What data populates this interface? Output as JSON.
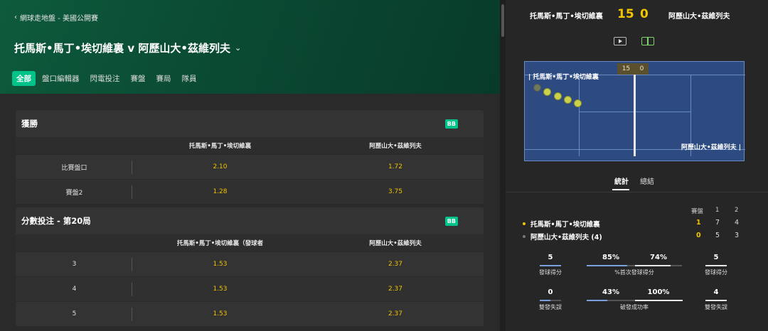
{
  "breadcrumb": {
    "back_icon": "chevron-left-icon",
    "text": "網球走地盤 - 美國公開賽"
  },
  "match": {
    "title": "托馬斯•馬丁•埃切維裏 v 阿歷山大•茲維列夫",
    "dropdown_icon": "chevron-down-icon"
  },
  "tabs": [
    {
      "label": "全部",
      "active": true
    },
    {
      "label": "盤口編輯器",
      "active": false
    },
    {
      "label": "閃電投注",
      "active": false
    },
    {
      "label": "賽盤",
      "active": false
    },
    {
      "label": "賽局",
      "active": false
    },
    {
      "label": "隊員",
      "active": false
    }
  ],
  "markets": [
    {
      "title": "獲勝",
      "badge": "BB",
      "columns": [
        "托馬斯•馬丁•埃切維裏",
        "阿歷山大•茲維列夫"
      ],
      "rows": [
        {
          "label": "比賽盤口",
          "odds": [
            "2.10",
            "1.72"
          ]
        },
        {
          "label": "賽盤2",
          "odds": [
            "1.28",
            "3.75"
          ]
        }
      ]
    },
    {
      "title": "分數投注 - 第20局",
      "badge": "BB",
      "columns": [
        "托馬斯•馬丁•埃切維裏（發球者",
        "阿歷山大•茲維列夫"
      ],
      "rows": [
        {
          "label": "3",
          "odds": [
            "1.53",
            "2.37"
          ]
        },
        {
          "label": "4",
          "odds": [
            "1.53",
            "2.37"
          ]
        },
        {
          "label": "5",
          "odds": [
            "1.53",
            "2.37"
          ]
        }
      ]
    }
  ],
  "scoreboard": {
    "player1": "托馬斯•馬丁•埃切維裏",
    "player2": "阿歷山大•茲維列夫",
    "score1": "15",
    "score2": "0",
    "icons": [
      "video-icon",
      "court-view-icon"
    ]
  },
  "court": {
    "score1": "15",
    "score2": "0",
    "player1": "托馬斯•馬丁•埃切維裏",
    "player2": "阿歷山大•茲維列夫"
  },
  "stats_tabs": {
    "active": "統計",
    "other": "總結"
  },
  "sets": {
    "header": [
      "賽盤",
      "1",
      "2"
    ],
    "rows": [
      {
        "name": "托馬斯•馬丁•埃切維裏",
        "current": "1",
        "set1": "7",
        "set2": "4",
        "serving": true
      },
      {
        "name": "阿歷山大•茲維列夫 (4)",
        "current": "0",
        "set1": "5",
        "set2": "3",
        "serving": false
      }
    ]
  },
  "stats": [
    {
      "left": "5",
      "label": "發球得分",
      "right": "5",
      "mid_left": "85%",
      "mid_right": "74%",
      "mid_label": "%首次發球得分",
      "fill_left": 0.85,
      "fill_right": 0.74
    },
    {
      "left": "0",
      "label": "雙發失誤",
      "right": "4",
      "mid_left": "43%",
      "mid_right": "100%",
      "mid_label": "破發成功率",
      "fill_left": 0.43,
      "fill_right": 1.0
    }
  ],
  "colors": {
    "accent": "#00c389",
    "odds": "#f2c400",
    "hero": "#0a4a33"
  }
}
